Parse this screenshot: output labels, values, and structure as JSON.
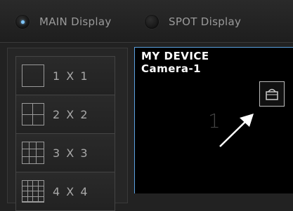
{
  "display_selector": {
    "main": {
      "label": "MAIN Display",
      "selected": true
    },
    "spot": {
      "label": "SPOT Display",
      "selected": false
    }
  },
  "layouts": [
    {
      "label": "1 X 1",
      "icon": "layout-1x1-icon"
    },
    {
      "label": "2 X 2",
      "icon": "layout-2x2-icon"
    },
    {
      "label": "3 X 3",
      "icon": "layout-3x3-icon"
    },
    {
      "label": "4 X 4",
      "icon": "layout-4x4-icon"
    }
  ],
  "camera_tile": {
    "device_name": "MY DEVICE",
    "camera_name": "Camera-1",
    "channel_number": "1",
    "action_icon": "camera-menu-icon"
  },
  "colors": {
    "accent": "#7fc7ff",
    "tile_border": "#5aa0e0",
    "annotation_arrow": "#ffffff"
  }
}
